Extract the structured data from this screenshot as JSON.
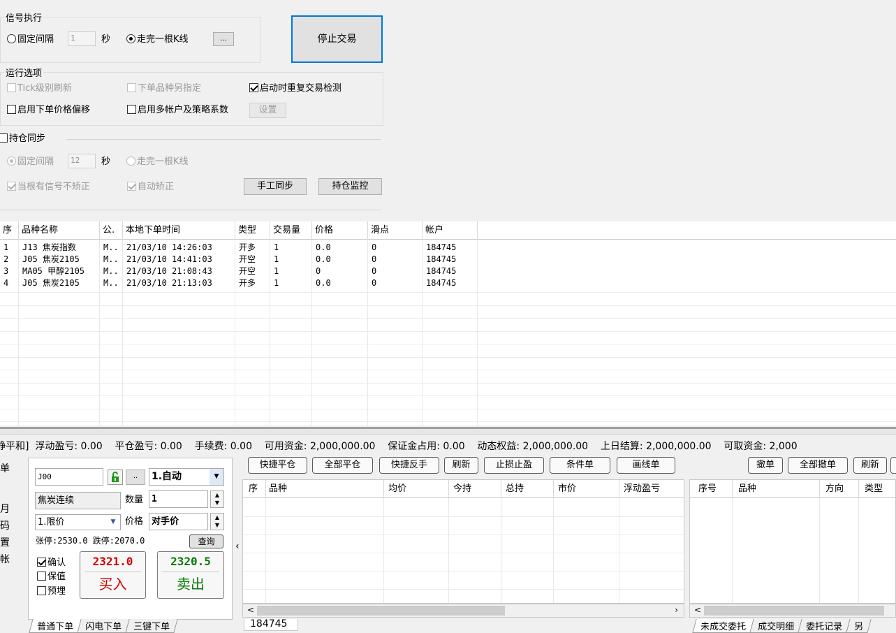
{
  "signal": {
    "title": "信号执行",
    "fixed_interval_label": "固定间隔",
    "interval_value": "1",
    "seconds_label": "秒",
    "per_kline_label": "走完一根K线",
    "more_button": "...",
    "stop_button": "停止交易"
  },
  "run_options": {
    "title": "运行选项",
    "tick_refresh": "Tick级别刷新",
    "alt_product": "下单品种另指定",
    "startup_check": "启动时重复交易检测",
    "price_offset": "启用下单价格偏移",
    "multi_account": "启用多帐户及策略系数",
    "settings_button": "设置"
  },
  "position_sync": {
    "title": "持仓同步",
    "fixed_interval_label": "固定间隔",
    "interval_value": "12",
    "seconds_label": "秒",
    "per_kline_label": "走完一根K线",
    "no_correct_label": "当根有信号不矫正",
    "auto_correct_label": "自动矫正",
    "manual_sync_button": "手工同步",
    "monitor_button": "持仓监控"
  },
  "orders_table": {
    "headers": [
      "序",
      "品种名称",
      "公.",
      "本地下单时间",
      "类型",
      "交易量",
      "价格",
      "滑点",
      "帐户"
    ],
    "rows": [
      [
        "1",
        "J13 焦炭指数",
        "M..",
        "21/03/10 14:26:03",
        "开多",
        "1",
        "0.0",
        "0",
        "184745"
      ],
      [
        "2",
        "J05 焦炭2105",
        "M..",
        "21/03/10 14:41:03",
        "开空",
        "1",
        "0.0",
        "0",
        "184745"
      ],
      [
        "3",
        "MA05 甲醇2105",
        "M..",
        "21/03/10 21:08:43",
        "开空",
        "1",
        "0",
        "0",
        "184745"
      ],
      [
        "4",
        "J05 焦炭2105",
        "M..",
        "21/03/10 21:13:03",
        "开多",
        "1",
        "0.0",
        "0",
        "184745"
      ]
    ]
  },
  "status_bar": {
    "text": "静平和]  浮动盈亏: 0.00    平仓盈亏: 0.00    手续费: 0.00    可用资金: 2,000,000.00    保证金占用: 0.00    动态权益: 2,000,000.00    上日结算: 2,000,000.00    可取资金: 2,000"
  },
  "left_side_labels": [
    "单",
    "月",
    "码",
    "置",
    "帐"
  ],
  "order_panel": {
    "contract": "J00",
    "more_button": "..",
    "mode": "1.自动",
    "name": "焦炭连续",
    "qty_label": "数量",
    "qty_value": "1",
    "price_type": "1.限价",
    "price_label": "价格",
    "price_value": "对手价",
    "limits": "张停:2530.0 跌停:2070.0",
    "query_button": "查询",
    "confirm_label": "确认",
    "hedge_label": "保值",
    "preset_label": "预埋",
    "buy_price": "2321.0",
    "buy_label": "买入",
    "sell_price": "2320.5",
    "sell_label": "卖出",
    "tabs": [
      "普通下单",
      "闪电下单",
      "三键下单"
    ]
  },
  "position_panel": {
    "buttons": [
      "快捷平仓",
      "全部平仓",
      "快捷反手",
      "刷新",
      "止损止盈",
      "条件单",
      "画线单"
    ],
    "headers": [
      "序",
      "品种",
      "均价",
      "今持",
      "总持",
      "市价",
      "浮动盈亏"
    ],
    "account_tab": "184745"
  },
  "entrust_panel": {
    "buttons": [
      "撤单",
      "全部撤单",
      "刷新"
    ],
    "headers": [
      "序号",
      "品种",
      "方向",
      "类型"
    ],
    "tabs": [
      "未成交委托",
      "成交明细",
      "委托记录",
      "另"
    ]
  }
}
